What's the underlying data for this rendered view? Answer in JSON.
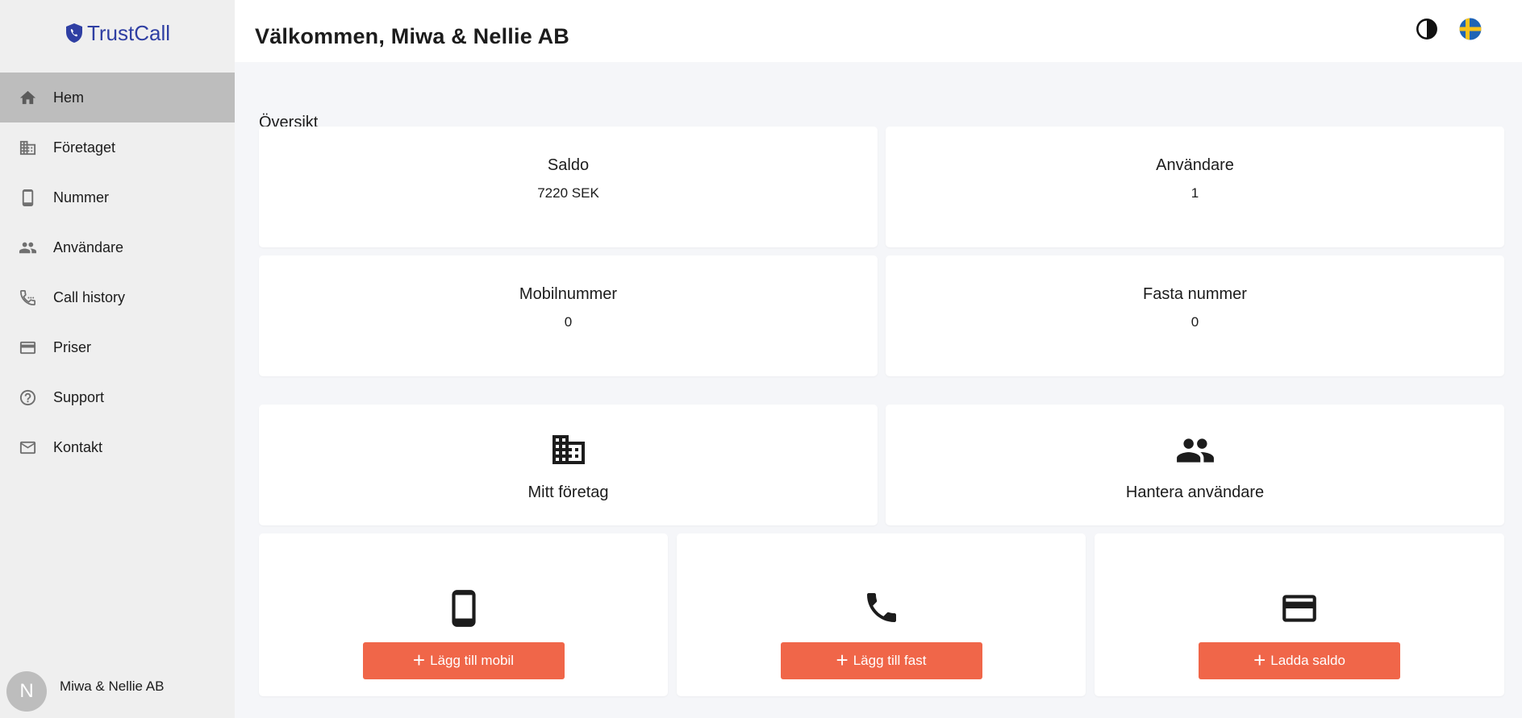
{
  "app": {
    "brand": "TrustCall"
  },
  "sidebar": {
    "items": [
      {
        "label": "Hem",
        "icon": "home-icon"
      },
      {
        "label": "Företaget",
        "icon": "building-icon"
      },
      {
        "label": "Nummer",
        "icon": "phone-device-icon"
      },
      {
        "label": "Användare",
        "icon": "users-icon"
      },
      {
        "label": "Call history",
        "icon": "call-history-icon"
      },
      {
        "label": "Priser",
        "icon": "card-icon"
      },
      {
        "label": "Support",
        "icon": "help-icon"
      },
      {
        "label": "Kontakt",
        "icon": "mail-icon"
      }
    ],
    "active_item": "Hem"
  },
  "profile": {
    "initial": "N",
    "name": "Miwa & Nellie AB"
  },
  "header": {
    "title": "Välkommen, Miwa & Nellie AB"
  },
  "main": {
    "section_title": "Översikt",
    "stats": [
      {
        "label": "Saldo",
        "value": "7220 SEK"
      },
      {
        "label": "Användare",
        "value": "1"
      },
      {
        "label": "Mobilnummer",
        "value": "0"
      },
      {
        "label": "Fasta nummer",
        "value": "0"
      }
    ],
    "links": [
      {
        "label": "Mitt företag",
        "icon": "building-icon"
      },
      {
        "label": "Hantera användare",
        "icon": "users-icon"
      }
    ],
    "actions": [
      {
        "label": "Lägg till mobil",
        "icon": "mobile-icon"
      },
      {
        "label": "Lägg till fast",
        "icon": "phone-icon"
      },
      {
        "label": "Ladda saldo",
        "icon": "credit-card-icon"
      }
    ]
  },
  "colors": {
    "accent": "#f06649",
    "brand": "#2f3fa3",
    "active_nav": "#bdbdbd"
  }
}
